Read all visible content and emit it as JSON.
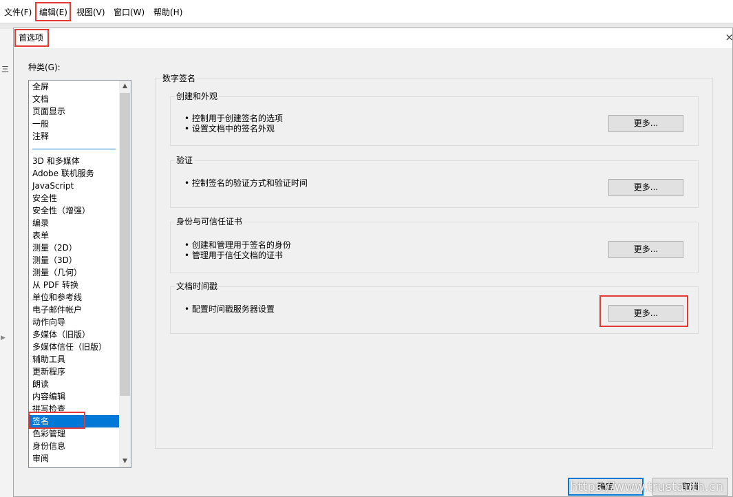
{
  "menubar": {
    "items": [
      "文件(F)",
      "编辑(E)",
      "视图(V)",
      "窗口(W)",
      "帮助(H)"
    ]
  },
  "gutter": {
    "letter": "三"
  },
  "dialog": {
    "title": "首选项",
    "close": "×",
    "category_label": "种类(G):",
    "categories_top": [
      "全屏",
      "文档",
      "页面显示",
      "一般",
      "注释"
    ],
    "categories": [
      "3D 和多媒体",
      "Adobe 联机服务",
      "JavaScript",
      "安全性",
      "安全性（增强）",
      "编录",
      "表单",
      "测量（2D）",
      "测量（3D）",
      "测量（几何）",
      "从 PDF 转换",
      "单位和参考线",
      "电子邮件帐户",
      "动作向导",
      "多媒体（旧版）",
      "多媒体信任（旧版）",
      "辅助工具",
      "更新程序",
      "朗读",
      "内容编辑",
      "拼写检查",
      "签名",
      "色彩管理",
      "身份信息",
      "审阅"
    ],
    "selected_category": "签名",
    "panel_title": "数字签名",
    "groups": [
      {
        "title": "创建和外观",
        "bullets": [
          "• 控制用于创建签名的选项",
          "• 设置文档中的签名外观"
        ],
        "button": "更多..."
      },
      {
        "title": "验证",
        "bullets": [
          "• 控制签名的验证方式和验证时间"
        ],
        "button": "更多..."
      },
      {
        "title": "身份与可信任证书",
        "bullets": [
          "• 创建和管理用于签名的身份",
          "• 管理用于信任文档的证书"
        ],
        "button": "更多..."
      },
      {
        "title": "文档时间戳",
        "bullets": [
          "• 配置时间戳服务器设置"
        ],
        "button": "更多..."
      }
    ],
    "ok": "确定",
    "cancel": "取消"
  },
  "watermark": "https://www.trustauth.cn",
  "colors": {
    "selection": "#0078d7",
    "highlight": "#e53935"
  }
}
